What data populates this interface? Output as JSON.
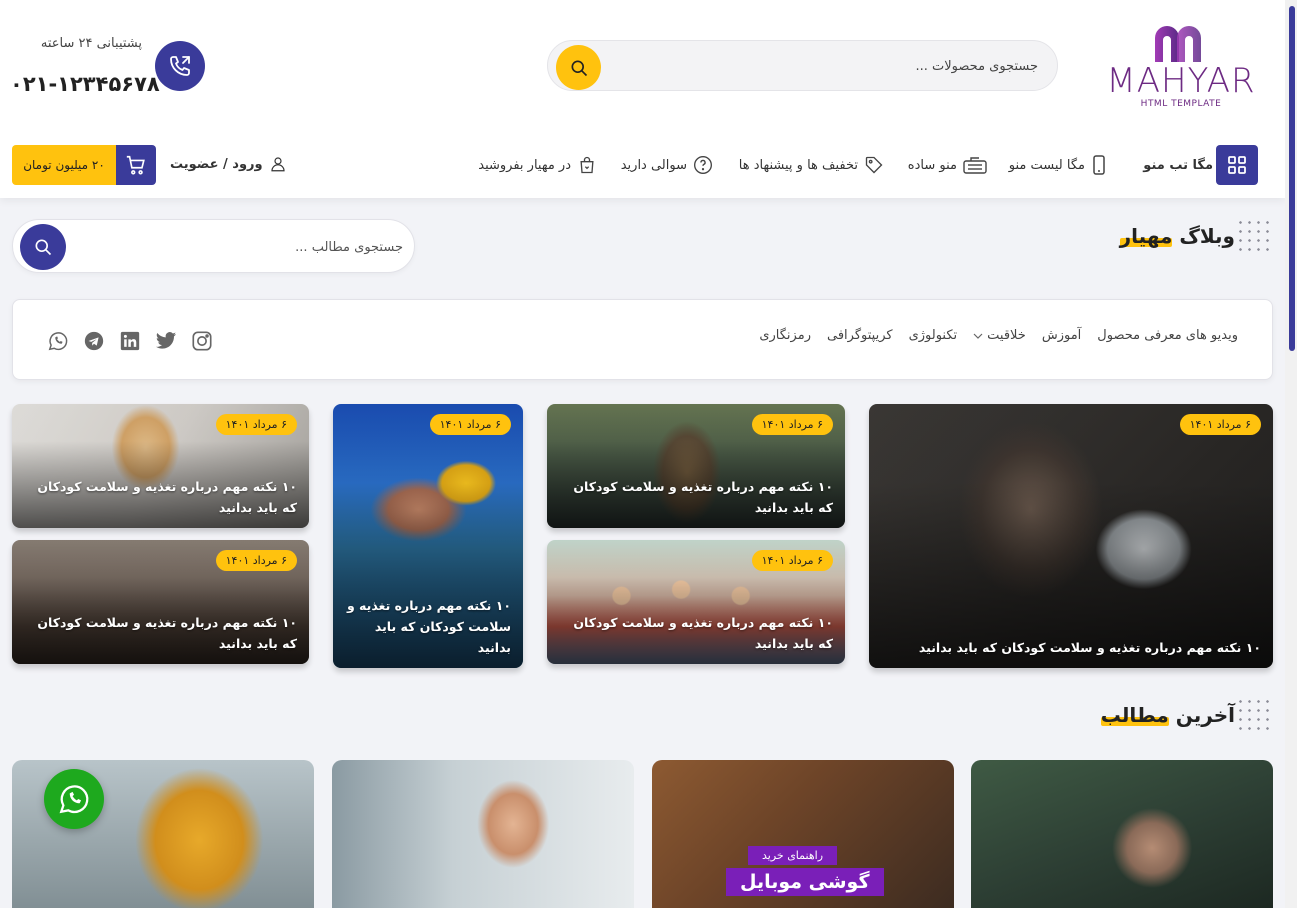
{
  "brand": {
    "logo_text": "MAHYAR",
    "logo_sub": "HTML TEMPLATE",
    "primary_color": "#3a3b9a",
    "accent_color": "#ffc20e",
    "logo_color": "#6d2a83"
  },
  "header": {
    "search_placeholder": "جستجوی محصولات ...",
    "support_title": "پشتیبانی ۲۴ ساعته",
    "support_number": "۰۲۱-۱۲۳۴۵۶۷۸"
  },
  "nav": {
    "mega_tab": "مگا تب منو",
    "mega_list": "مگا لیست منو",
    "simple_menu": "منو ساده",
    "offers": "تخفیف ها و پیشنهاد ها",
    "questions": "سوالی دارید",
    "sell": "در مهیار بفروشید",
    "login": "ورود / عضویت",
    "cart_price": "۲۰ میلیون تومان"
  },
  "blog": {
    "title_prefix": "وبلاگ ",
    "title_highlight": "مهیار",
    "search_placeholder": "جستجوی مطالب ..."
  },
  "categories": [
    "ویدیو های معرفی محصول",
    "آموزش",
    "خلاقیت",
    "تکنولوژی",
    "کریپتوگرافی",
    "رمزنگاری"
  ],
  "socials": [
    "instagram-icon",
    "twitter-icon",
    "linkedin-icon",
    "telegram-icon",
    "whatsapp-icon"
  ],
  "featured_posts": [
    {
      "date": "۶ مرداد ۱۴۰۱",
      "title": "۱۰ نکته مهم درباره تغذیه و سلامت کودکان که باید بدانید"
    },
    {
      "date": "۶ مرداد ۱۴۰۱",
      "title": "۱۰ نکته مهم درباره تغذیه و سلامت کودکان که باید بدانید"
    },
    {
      "date": "۶ مرداد ۱۴۰۱",
      "title": "۱۰ نکته مهم درباره تغذیه و سلامت کودکان که باید بدانید"
    },
    {
      "date": "۶ مرداد ۱۴۰۱",
      "title": "۱۰ نکته مهم درباره تغذیه و سلامت کودکان که باید بدانید"
    },
    {
      "date": "۶ مرداد ۱۴۰۱",
      "title": "۱۰ نکته مهم درباره تغذیه و سلامت کودکان که باید بدانید"
    },
    {
      "date": "۶ مرداد ۱۴۰۱",
      "title": "۱۰ نکته مهم درباره تغذیه و سلامت کودکان که باید بدانید"
    }
  ],
  "latest": {
    "title_prefix": "آخرین ",
    "title_highlight": "مطالب",
    "guide_small": "راهنمای خرید",
    "guide_big": "گوشی موبایل"
  }
}
